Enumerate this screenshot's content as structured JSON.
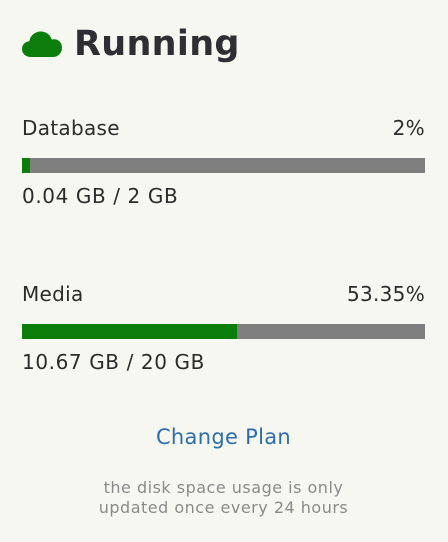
{
  "status": {
    "icon": "cloud-icon",
    "title": "Running",
    "color": "#0a7d0a"
  },
  "database": {
    "label": "Database",
    "percent_label": "2%",
    "fill_fraction": 0.02,
    "amount": "0.04 GB / 2 GB"
  },
  "media": {
    "label": "Media",
    "percent_label": "53.35%",
    "fill_fraction": 0.5335,
    "amount": "10.67 GB / 20 GB"
  },
  "actions": {
    "change_plan": "Change Plan"
  },
  "footnote": {
    "line1": "the disk space usage is only",
    "line2": "updated once every 24 hours"
  },
  "colors": {
    "background": "#f7f7f2",
    "bar_track": "#7f7f7f",
    "bar_fill": "#0a7d0a",
    "link": "#2e6dad"
  }
}
